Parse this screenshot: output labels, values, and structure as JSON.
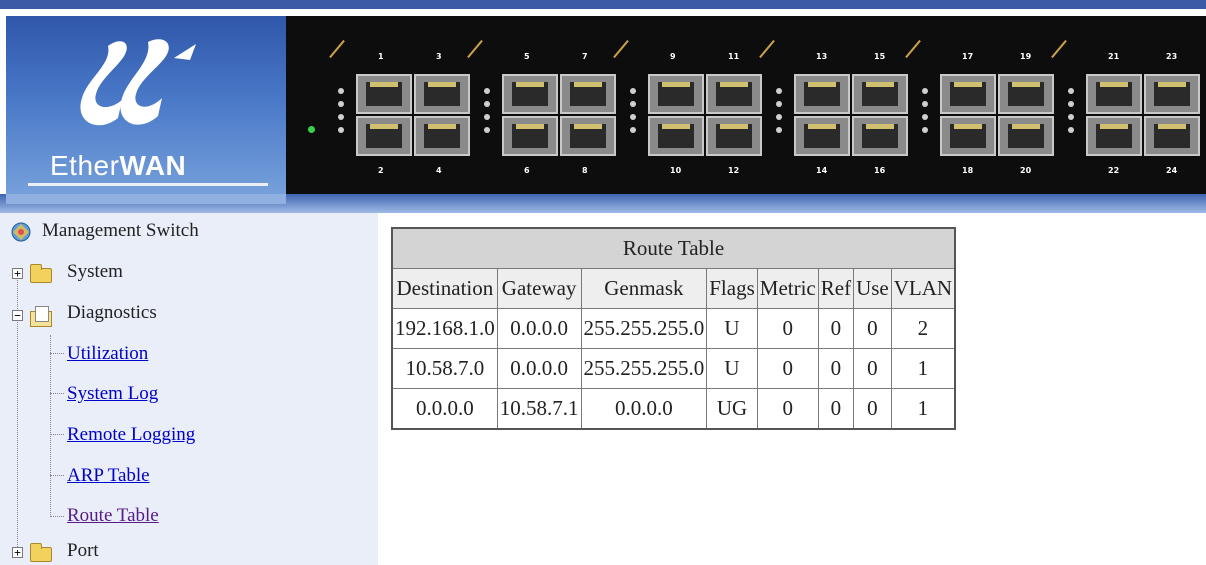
{
  "brand": {
    "logo_text_ether": "Ether",
    "logo_text_wan": "WAN"
  },
  "switch": {
    "ports_top": [
      "1",
      "3",
      "5",
      "7",
      "9",
      "11",
      "13",
      "15",
      "17",
      "19",
      "21",
      "23"
    ],
    "ports_bottom": [
      "2",
      "4",
      "6",
      "8",
      "10",
      "12",
      "14",
      "16",
      "18",
      "20",
      "22",
      "24"
    ]
  },
  "sidebar": {
    "root_label": "Management Switch",
    "system_label": "System",
    "diagnostics_label": "Diagnostics",
    "diagnostics_items": [
      "Utilization",
      "System Log",
      "Remote Logging",
      "ARP Table",
      "Route Table"
    ],
    "port_label": "Port"
  },
  "route_table": {
    "title": "Route Table",
    "columns": [
      "Destination",
      "Gateway",
      "Genmask",
      "Flags",
      "Metric",
      "Ref",
      "Use",
      "VLAN"
    ],
    "rows": [
      [
        "192.168.1.0",
        "0.0.0.0",
        "255.255.255.0",
        "U",
        "0",
        "0",
        "0",
        "2"
      ],
      [
        "10.58.7.0",
        "0.0.0.0",
        "255.255.255.0",
        "U",
        "0",
        "0",
        "0",
        "1"
      ],
      [
        "0.0.0.0",
        "10.58.7.1",
        "0.0.0.0",
        "UG",
        "0",
        "0",
        "0",
        "1"
      ]
    ]
  },
  "colors": {
    "header_blue": "#3a5ba5",
    "sidebar_bg": "#e9eef8",
    "link": "#0000cc",
    "link_visited": "#551a8b",
    "table_title_bg": "#d4d4d4"
  }
}
